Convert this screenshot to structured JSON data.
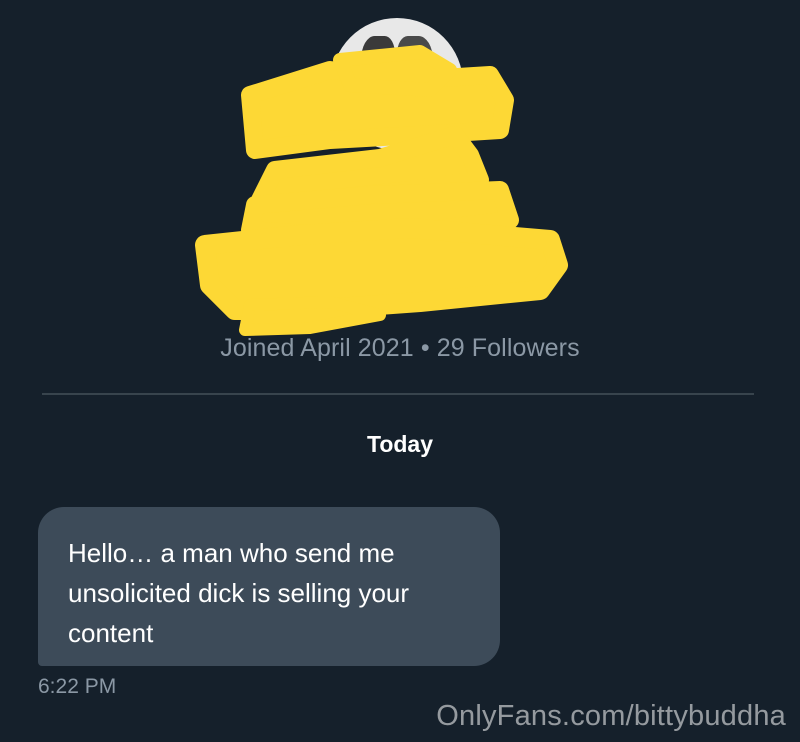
{
  "profile": {
    "meta": "Joined April 2021 • 29 Followers"
  },
  "conversation": {
    "date_separator": "Today",
    "messages": [
      {
        "text": "Hello… a man who send me unsolicited dick is selling your content",
        "time": "6:22 PM"
      }
    ]
  },
  "watermark": "OnlyFans.com/bittybuddha",
  "colors": {
    "background": "#15202b",
    "bubble": "#3d4b59",
    "muted_text": "#8b98a5",
    "redaction": "#fdd835"
  },
  "icons": {
    "avatar": "profile-avatar"
  }
}
